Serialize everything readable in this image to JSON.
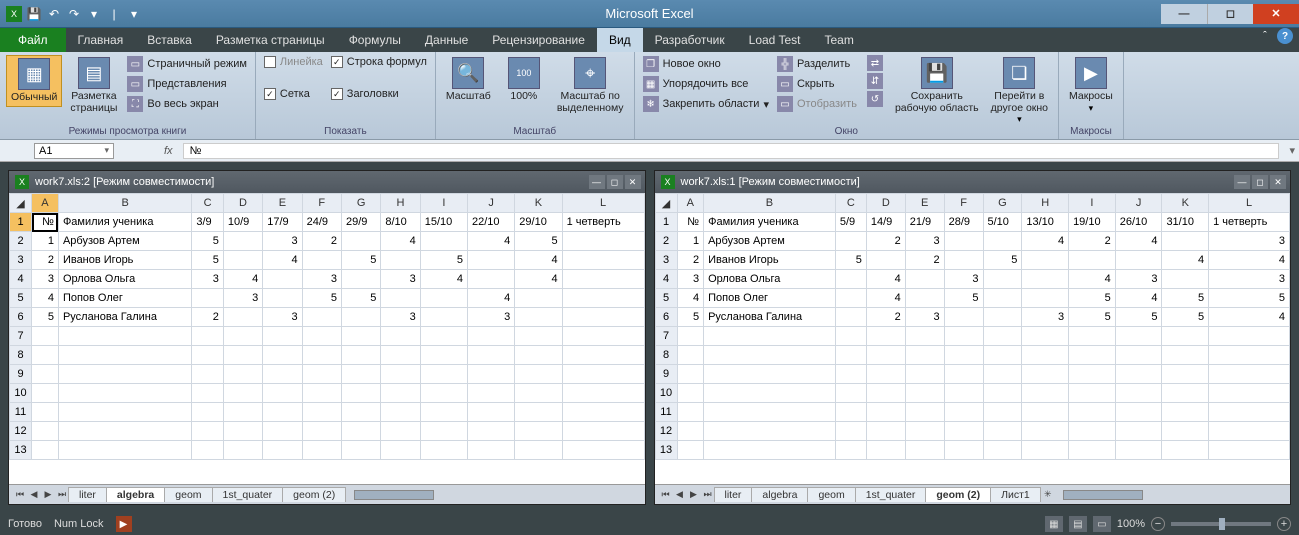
{
  "app": {
    "title": "Microsoft Excel"
  },
  "qat": {
    "save": "💾",
    "undo": "↶",
    "redo": "↷"
  },
  "titlebuttons": {
    "min": "—",
    "max": "◻",
    "close": "✕"
  },
  "tabs": {
    "file": "Файл",
    "items": [
      "Главная",
      "Вставка",
      "Разметка страницы",
      "Формулы",
      "Данные",
      "Рецензирование",
      "Вид",
      "Разработчик",
      "Load Test",
      "Team"
    ],
    "active": 6
  },
  "ribbon": {
    "group1": {
      "label": "Режимы просмотра книги",
      "normal": "Обычный",
      "pagelayout": "Разметка\nстраницы",
      "pagebreak": "Страничный режим",
      "customviews": "Представления",
      "fullscreen": "Во весь экран"
    },
    "group2": {
      "label": "Показать",
      "ruler": "Линейка",
      "gridlines": "Сетка",
      "formulabar": "Строка формул",
      "headings": "Заголовки"
    },
    "group3": {
      "label": "Масштаб",
      "zoom": "Масштаб",
      "hundred": "100%",
      "tosel": "Масштаб по\nвыделенному"
    },
    "group4": {
      "label": "Окно",
      "newwin": "Новое окно",
      "arrange": "Упорядочить все",
      "freeze": "Закрепить области",
      "split": "Разделить",
      "hide": "Скрыть",
      "unhide": "Отобразить",
      "savews": "Сохранить\nрабочую область",
      "switchwin": "Перейти в\nдругое окно"
    },
    "group5": {
      "label": "Макросы",
      "macros": "Макросы"
    }
  },
  "formulabar": {
    "namebox": "A1",
    "fx": "fx",
    "value": "№"
  },
  "windows": [
    {
      "title": "work7.xls:2  [Режим совместимости]",
      "cols": [
        "A",
        "B",
        "C",
        "D",
        "E",
        "F",
        "G",
        "H",
        "I",
        "J",
        "K",
        "L"
      ],
      "selcol": 0,
      "rows": [
        [
          "№",
          "Фамилия ученика",
          "3/9",
          "10/9",
          "17/9",
          "24/9",
          "29/9",
          "8/10",
          "15/10",
          "22/10",
          "29/10",
          "1 четверть"
        ],
        [
          "1",
          "Арбузов Артем",
          "5",
          "",
          "3",
          "2",
          "",
          "4",
          "",
          "4",
          "5",
          ""
        ],
        [
          "2",
          "Иванов Игорь",
          "5",
          "",
          "4",
          "",
          "5",
          "",
          "5",
          "",
          "4",
          ""
        ],
        [
          "3",
          "Орлова Ольга",
          "3",
          "4",
          "",
          "3",
          "",
          "3",
          "4",
          "",
          "4",
          ""
        ],
        [
          "4",
          "Попов Олег",
          "",
          "3",
          "",
          "5",
          "5",
          "",
          "",
          "4",
          "",
          ""
        ],
        [
          "5",
          "Русланова Галина",
          "2",
          "",
          "3",
          "",
          "",
          "3",
          "",
          "3",
          "",
          ""
        ]
      ],
      "emptyrows": [
        "7",
        "8",
        "9",
        "10",
        "11",
        "12",
        "13"
      ],
      "tabs": [
        "liter",
        "algebra",
        "geom",
        "1st_quater",
        "geom (2)"
      ],
      "activetab": 1
    },
    {
      "title": "work7.xls:1  [Режим совместимости]",
      "cols": [
        "A",
        "B",
        "C",
        "D",
        "E",
        "F",
        "G",
        "H",
        "I",
        "J",
        "K",
        "L"
      ],
      "selcol": -1,
      "rows": [
        [
          "№",
          "Фамилия ученика",
          "5/9",
          "14/9",
          "21/9",
          "28/9",
          "5/10",
          "13/10",
          "19/10",
          "26/10",
          "31/10",
          "1 четверть"
        ],
        [
          "1",
          "Арбузов Артем",
          "",
          "2",
          "3",
          "",
          "",
          "4",
          "2",
          "4",
          "",
          "3"
        ],
        [
          "2",
          "Иванов Игорь",
          "5",
          "",
          "2",
          "",
          "5",
          "",
          "",
          "",
          "4",
          "4"
        ],
        [
          "3",
          "Орлова Ольга",
          "",
          "4",
          "",
          "3",
          "",
          "",
          "4",
          "3",
          "",
          "3"
        ],
        [
          "4",
          "Попов Олег",
          "",
          "4",
          "",
          "5",
          "",
          "",
          "5",
          "4",
          "5",
          "5"
        ],
        [
          "5",
          "Русланова Галина",
          "",
          "2",
          "3",
          "",
          "",
          "3",
          "5",
          "5",
          "5",
          "4"
        ]
      ],
      "emptyrows": [
        "7",
        "8",
        "9",
        "10",
        "11",
        "12",
        "13"
      ],
      "tabs": [
        "liter",
        "algebra",
        "geom",
        "1st_quater",
        "geom (2)",
        "Лист1"
      ],
      "activetab": 4
    }
  ],
  "statusbar": {
    "ready": "Готово",
    "numlock": "Num Lock",
    "zoom": "100%",
    "minus": "−",
    "plus": "+"
  }
}
